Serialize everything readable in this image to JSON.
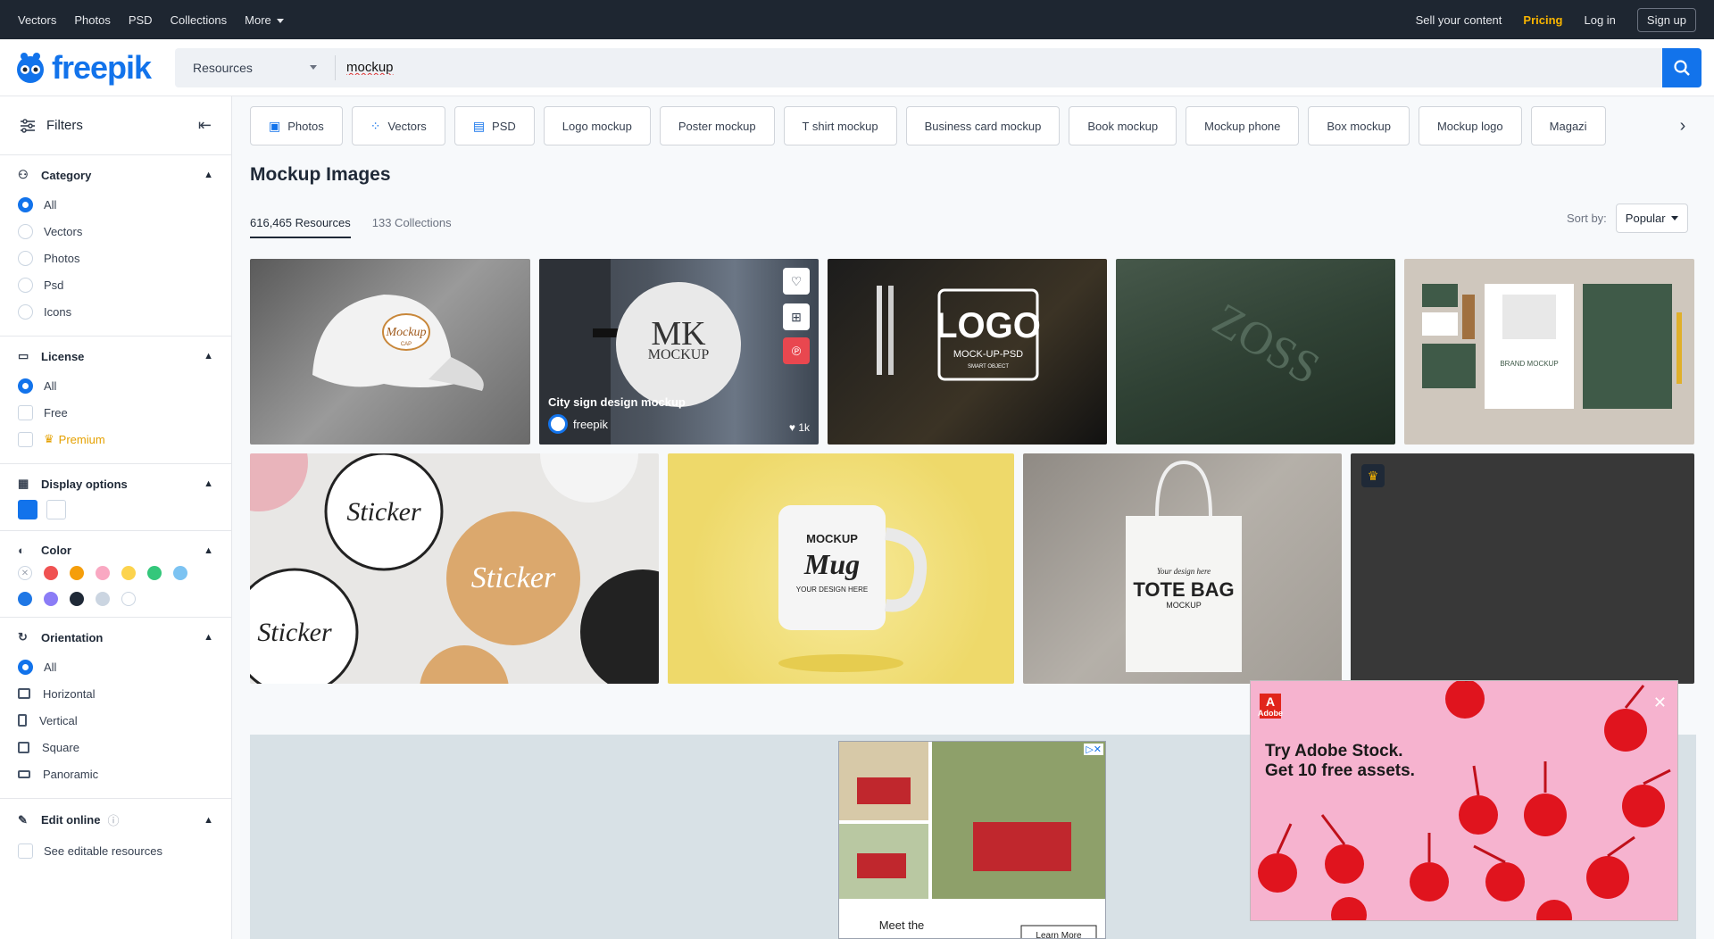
{
  "topbar": {
    "nav": [
      "Vectors",
      "Photos",
      "PSD",
      "Collections"
    ],
    "more_label": "More",
    "sell": "Sell your content",
    "pricing": "Pricing",
    "login": "Log in",
    "signup": "Sign up"
  },
  "header": {
    "logo": "freepik",
    "resource_select": "Resources",
    "search_value": "mockup"
  },
  "sidebar": {
    "title": "Filters",
    "category": {
      "title": "Category",
      "options": [
        "All",
        "Vectors",
        "Photos",
        "Psd",
        "Icons"
      ],
      "selected": "All"
    },
    "license": {
      "title": "License",
      "options": [
        "All",
        "Free",
        "Premium"
      ],
      "selected": "All"
    },
    "display": {
      "title": "Display options"
    },
    "color": {
      "title": "Color",
      "swatches": [
        "#ffffff",
        "#f05252",
        "#f59e0b",
        "#f9a8c2",
        "#fcd34d",
        "#34c77b",
        "#7cc3f2",
        "#1f77e5",
        "#8b7cf6",
        "#1f2937",
        "#cbd5e1",
        "#ffffff"
      ]
    },
    "orientation": {
      "title": "Orientation",
      "options": [
        "All",
        "Horizontal",
        "Vertical",
        "Square",
        "Panoramic"
      ],
      "selected": "All"
    },
    "edit": {
      "title": "Edit online",
      "option": "See editable resources"
    }
  },
  "chips": [
    {
      "label": "Photos",
      "icon": "photo-icon"
    },
    {
      "label": "Vectors",
      "icon": "vector-icon"
    },
    {
      "label": "PSD",
      "icon": "psd-icon"
    },
    {
      "label": "Logo mockup"
    },
    {
      "label": "Poster mockup"
    },
    {
      "label": "T shirt mockup"
    },
    {
      "label": "Business card mockup"
    },
    {
      "label": "Book mockup"
    },
    {
      "label": "Mockup phone"
    },
    {
      "label": "Box mockup"
    },
    {
      "label": "Mockup logo"
    },
    {
      "label": "Magazi"
    }
  ],
  "main": {
    "title": "Mockup Images",
    "tab_resources": "616,465 Resources",
    "tab_collections": "133 Collections",
    "sort_label": "Sort by:",
    "sort_value": "Popular"
  },
  "tiles": {
    "cap_text": "Mockup",
    "cap_sub": "CAP",
    "sign_big": "MK",
    "sign_small": "MOCKUP",
    "sign_caption": "City sign design mockup",
    "sign_author": "freepik",
    "sign_likes": "1k",
    "logo_text": "LOGO",
    "logo_sub": "MOCK-UP-PSD",
    "logo_sub2": "SMART OBJECT",
    "zoss_text": "ZOSS",
    "brand_text": "BRAND MOCKUP",
    "sticker_text": "Sticker",
    "mug_top": "MOCKUP",
    "mug_mid": "Mug",
    "mug_bottom": "YOUR DESIGN HERE",
    "tote_small": "Your design here",
    "tote_big": "TOTE BAG",
    "tote_sub": "MOCKUP"
  },
  "ads": {
    "honda_text": "Meet the",
    "honda_btn": "Learn More",
    "adobe_line1": "Try Adobe Stock.",
    "adobe_line2": "Get 10 free assets.",
    "adobe_logo": "Adobe"
  }
}
